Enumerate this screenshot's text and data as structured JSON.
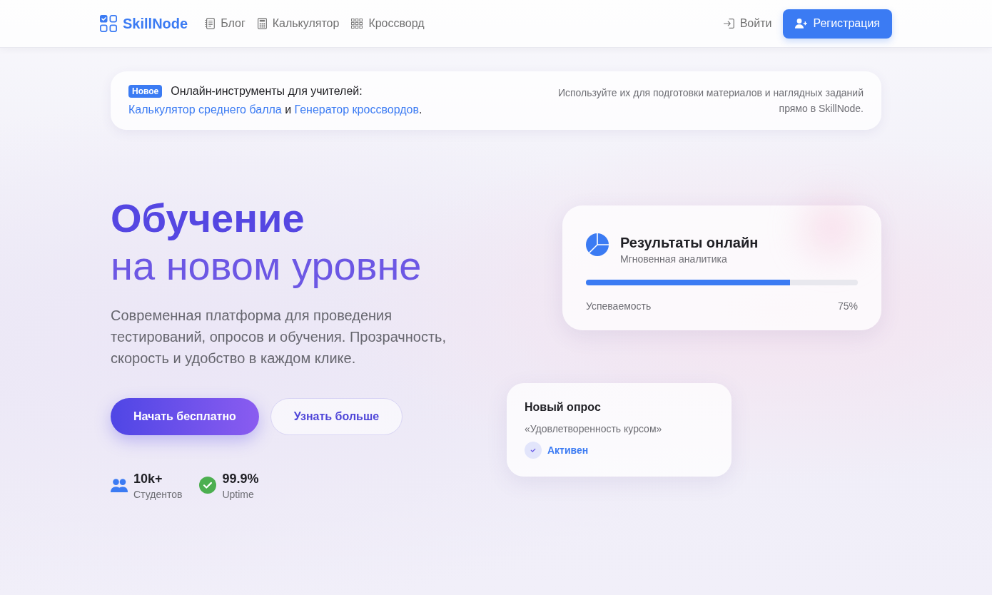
{
  "header": {
    "logo": "SkillNode",
    "nav": [
      "Блог",
      "Калькулятор",
      "Кроссворд"
    ],
    "login": "Войти",
    "register": "Регистрация"
  },
  "notice": {
    "badge": "Новое",
    "title": "Онлайн-инструменты для учителей:",
    "sentence": [
      {
        "kind": "link",
        "text": "Калькулятор среднего балла"
      },
      {
        "kind": "text",
        "text": " и "
      },
      {
        "kind": "link",
        "text": "Генератор кроссвордов"
      },
      {
        "kind": "text",
        "text": "."
      }
    ],
    "aside": "Используйте их для подготовки материалов и наглядных заданий прямо в SkillNode."
  },
  "hero": {
    "title": "Обучение",
    "subtitle": "на новом уровне",
    "description": "Современная платформа для проведения тестирований, опросов и обучения. Прозрачность, скорость и удобство в каждом клике.",
    "buttons": [
      {
        "label": "Начать бесплатно",
        "kind": "primary"
      },
      {
        "label": "Узнать больше",
        "kind": "secondary"
      }
    ],
    "stats": [
      {
        "value": "10k+",
        "label": "Студентов"
      },
      {
        "value": "99.9%",
        "label": "Uptime"
      }
    ]
  },
  "results_card": {
    "title": "Результаты онлайн",
    "subtitle": "Мгновенная аналитика",
    "progress": {
      "label": "Успеваемость",
      "reading": "75%",
      "level": 0.75
    }
  },
  "poll_card": {
    "title": "Новый опрос",
    "name": "«Удовлетворенность курсом»",
    "status": "Активен"
  }
}
